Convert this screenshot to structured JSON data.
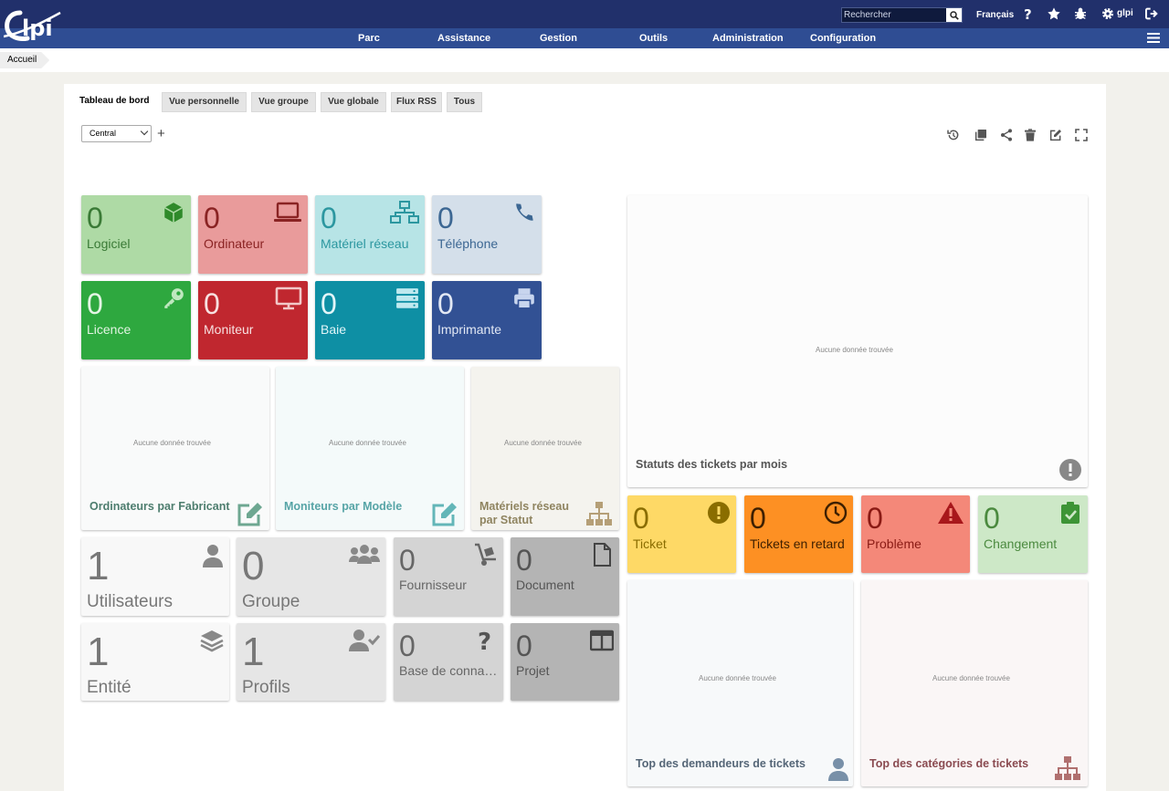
{
  "header": {
    "search_placeholder": "Rechercher",
    "language": "Français",
    "user": "glpi",
    "menu": [
      "Parc",
      "Assistance",
      "Gestion",
      "Outils",
      "Administration",
      "Configuration"
    ]
  },
  "breadcrumb": {
    "home": "Accueil"
  },
  "tabs": {
    "label": "Tableau de bord",
    "items": [
      "Vue personnelle",
      "Vue groupe",
      "Vue globale",
      "Flux RSS",
      "Tous"
    ]
  },
  "dashboard": {
    "selected": "Central"
  },
  "empty_text": "Aucune donnée trouvée",
  "asset_cards": [
    {
      "value": "0",
      "label": "Logiciel"
    },
    {
      "value": "0",
      "label": "Ordinateur"
    },
    {
      "value": "0",
      "label": "Matériel réseau"
    },
    {
      "value": "0",
      "label": "Téléphone"
    },
    {
      "value": "0",
      "label": "Licence"
    },
    {
      "value": "0",
      "label": "Moniteur"
    },
    {
      "value": "0",
      "label": "Baie"
    },
    {
      "value": "0",
      "label": "Imprimante"
    }
  ],
  "panels": {
    "computers_by_manufacturer": "Ordinateurs par Fabricant",
    "monitors_by_model": "Moniteurs par Modèle",
    "network_by_status_1": "Matériels réseau",
    "network_by_status_2": "par Statut",
    "ticket_status_by_month": "Statuts des tickets par mois",
    "top_requesters": "Top des demandeurs de tickets",
    "top_categories": "Top des catégories de tickets"
  },
  "admin_cards": [
    {
      "value": "1",
      "label": "Utilisateurs"
    },
    {
      "value": "0",
      "label": "Groupe"
    },
    {
      "value": "0",
      "label": "Fournisseur"
    },
    {
      "value": "0",
      "label": "Document"
    },
    {
      "value": "1",
      "label": "Entité"
    },
    {
      "value": "1",
      "label": "Profils"
    },
    {
      "value": "0",
      "label": "Base de conna…"
    },
    {
      "value": "0",
      "label": "Projet"
    }
  ],
  "ticket_cards": [
    {
      "value": "0",
      "label": "Ticket"
    },
    {
      "value": "0",
      "label": "Tickets en retard"
    },
    {
      "value": "0",
      "label": "Problème"
    },
    {
      "value": "0",
      "label": "Changement"
    }
  ]
}
